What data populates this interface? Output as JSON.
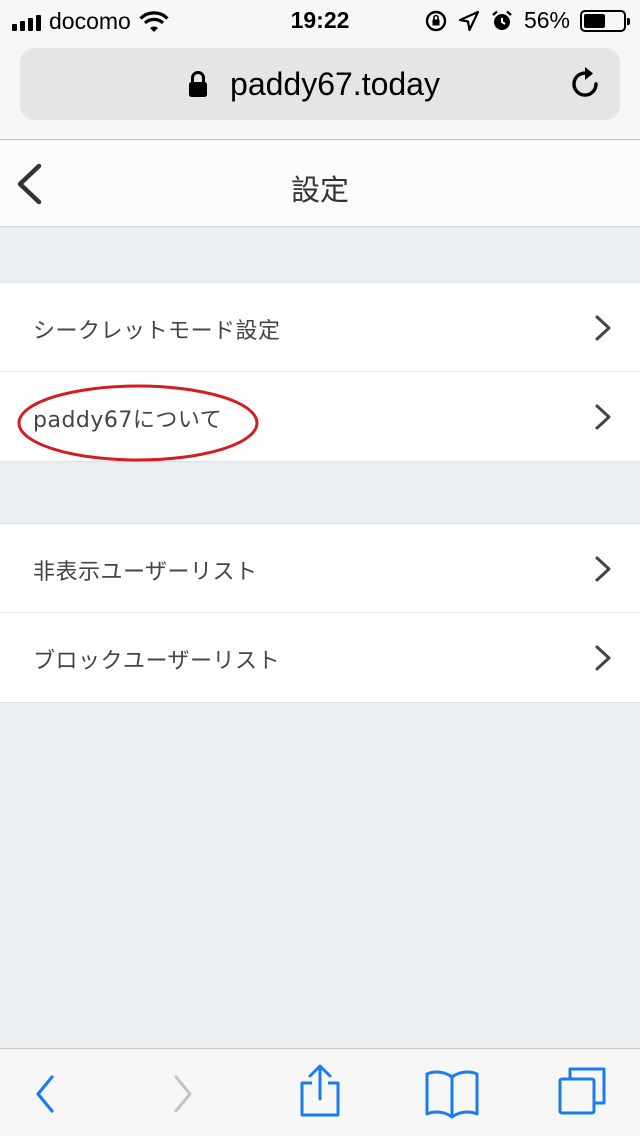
{
  "status_bar": {
    "carrier": "docomo",
    "time": "19:22",
    "battery_percent": "56%",
    "battery_level": 0.56
  },
  "browser": {
    "url": "paddy67.today"
  },
  "page": {
    "title": "設定"
  },
  "sections": [
    {
      "items": [
        {
          "label": "シークレットモード設定"
        },
        {
          "label": "paddy67について",
          "highlighted": true
        }
      ]
    },
    {
      "items": [
        {
          "label": "非表示ユーザーリスト"
        },
        {
          "label": "ブロックユーザーリスト"
        }
      ]
    }
  ],
  "colors": {
    "accent": "#1a7cf0",
    "highlight_ellipse": "#d41c22",
    "background": "#ebeef0"
  }
}
